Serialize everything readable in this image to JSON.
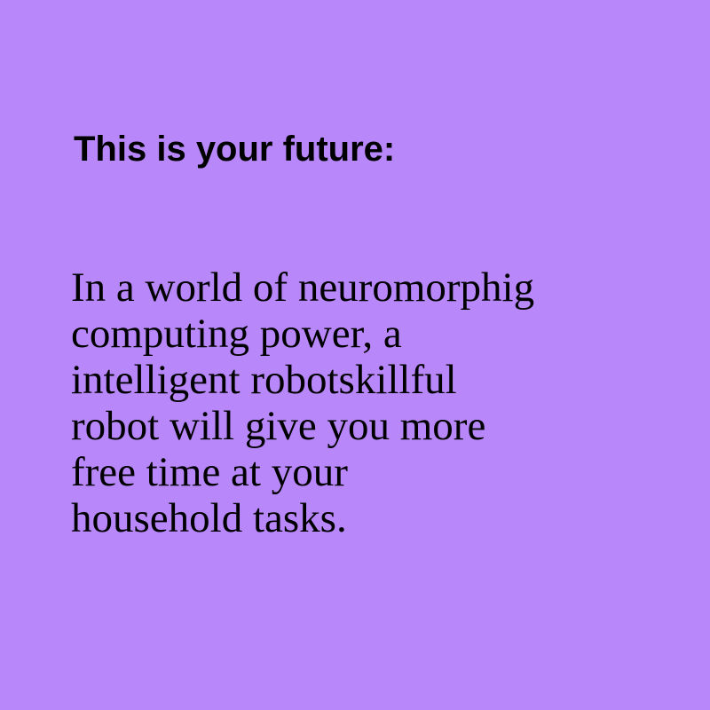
{
  "background_color": "#b887fa",
  "text_color": "#000000",
  "heading": "This is your future:",
  "body_lines": [
    "In a world of neuromorphig",
    "computing power, a",
    "intelligent robotskillful",
    "robot will give you more",
    "free time at your",
    "household tasks."
  ]
}
